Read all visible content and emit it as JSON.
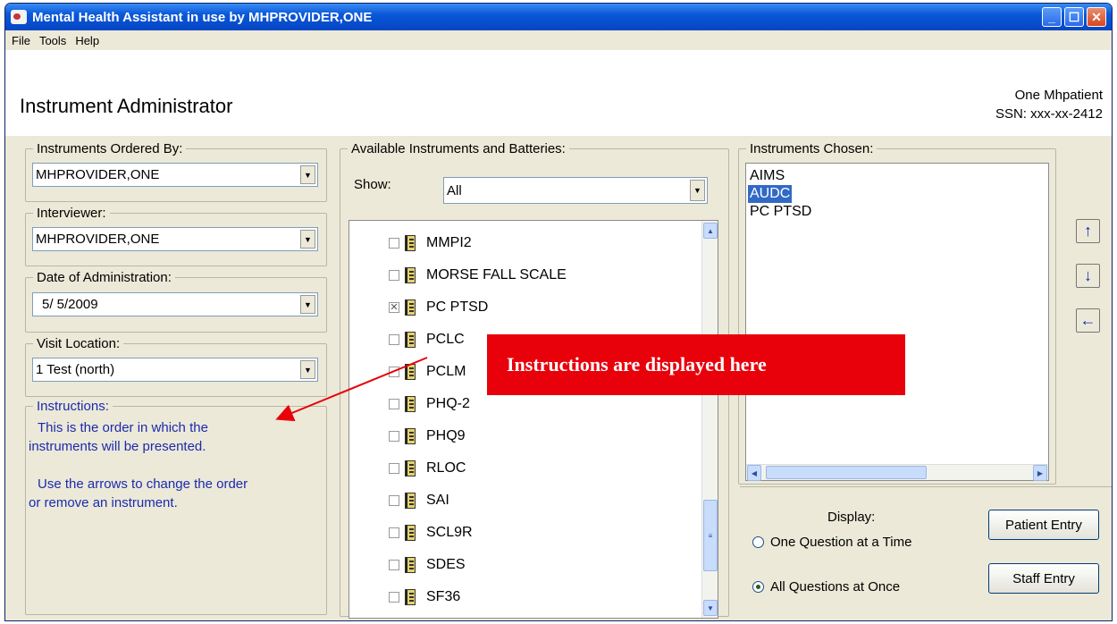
{
  "window": {
    "title": "Mental Health Assistant in use by MHPROVIDER,ONE"
  },
  "menu": [
    "File",
    "Tools",
    "Help"
  ],
  "header": {
    "title": "Instrument Administrator",
    "patient_name": "One Mhpatient",
    "ssn": "SSN: xxx-xx-2412"
  },
  "ordered_by": {
    "label": "Instruments Ordered By:",
    "value": "MHPROVIDER,ONE"
  },
  "interviewer": {
    "label": "Interviewer:",
    "value": "MHPROVIDER,ONE"
  },
  "date": {
    "label": "Date of Administration:",
    "value": "5/ 5/2009"
  },
  "location": {
    "label": "Visit Location:",
    "value": "1 Test (north)"
  },
  "instructions": {
    "label": "Instructions:",
    "line1": "This is the order in which the",
    "line2": "instruments will be presented.",
    "line3": "Use the arrows to change the order",
    "line4": "or remove an instrument."
  },
  "available": {
    "label": "Available Instruments and Batteries:",
    "show_label": "Show:",
    "show_value": "All",
    "items": [
      {
        "name": "MMPI2",
        "checked": false
      },
      {
        "name": "MORSE FALL SCALE",
        "checked": false
      },
      {
        "name": "PC PTSD",
        "checked": true
      },
      {
        "name": "PCLC",
        "checked": false
      },
      {
        "name": "PCLM",
        "checked": false
      },
      {
        "name": "PHQ-2",
        "checked": false
      },
      {
        "name": "PHQ9",
        "checked": false
      },
      {
        "name": "RLOC",
        "checked": false
      },
      {
        "name": "SAI",
        "checked": false
      },
      {
        "name": "SCL9R",
        "checked": false
      },
      {
        "name": "SDES",
        "checked": false
      },
      {
        "name": "SF36",
        "checked": false
      }
    ]
  },
  "chosen": {
    "label": "Instruments Chosen:",
    "items": [
      "AIMS",
      "AUDC",
      "PC PTSD"
    ],
    "selected": "AUDC"
  },
  "display": {
    "label": "Display:",
    "option1": "One Question at a Time",
    "option2": "All Questions at Once",
    "selected": 2
  },
  "buttons": {
    "patient": "Patient Entry",
    "staff": "Staff Entry"
  },
  "annotation": {
    "text": "Instructions are displayed here",
    "color": "#e8000b"
  }
}
